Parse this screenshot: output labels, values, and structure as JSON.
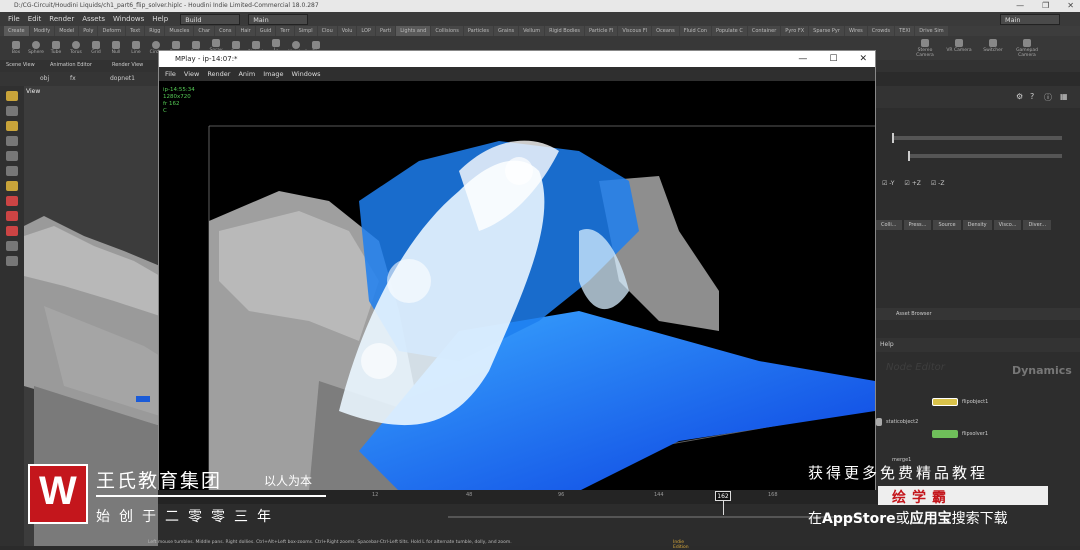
{
  "window": {
    "title": "D:/CG-Circuit/Houdini Liquids/ch1_part6_flip_solver.hiplc - Houdini Indie Limited-Commercial 18.0.287",
    "controls": [
      "—",
      "❐",
      "✕"
    ]
  },
  "menubar": {
    "items": [
      "File",
      "Edit",
      "Render",
      "Assets",
      "Windows",
      "Help"
    ],
    "build_dropdown": "Build",
    "main_dropdown": "Main",
    "right_dropdown": "Main"
  },
  "shelf_tabs": [
    "Create",
    "Modify",
    "Model",
    "Poly",
    "Deform",
    "Text",
    "Rigg",
    "Muscles",
    "Char",
    "Cons",
    "Hair",
    "Guid",
    "Terr",
    "Simpl",
    "Clou",
    "Volu",
    "LOP",
    "Parti",
    "Lights and",
    "Collisions",
    "Particles",
    "Grains",
    "Vellum",
    "Rigid Bodies",
    "Particle Fl",
    "Viscous Fl",
    "Oceans",
    "Fluid Con",
    "Populate C",
    "Container",
    "Pyro FX",
    "Sparse Pyr",
    "Wires",
    "Crowds",
    "TEXI",
    "Drive Sim"
  ],
  "shelf_tools": [
    "Box",
    "Sphere",
    "Tube",
    "Torus",
    "Grid",
    "Null",
    "Line",
    "Circle",
    "Curve",
    "Path",
    "Spray Paint",
    "Font",
    "Platonic",
    "L-System",
    "Metaball",
    "File"
  ],
  "shelf_right_tools": [
    "Stereo Camera",
    "VR Camera",
    "Switcher",
    "Gamepad Camera"
  ],
  "panel_tabs": [
    "Scene View",
    "Animation Editor",
    "Render View"
  ],
  "path": [
    "obj",
    "fx",
    "dopnet1"
  ],
  "viewport_label": "View",
  "mplay": {
    "title": "MPlay - ip-14:07:*",
    "menu": [
      "File",
      "View",
      "Render",
      "Anim",
      "Image",
      "Windows"
    ],
    "info": [
      "ip-14:55:34",
      "1280x720",
      "fr 162",
      "C"
    ]
  },
  "right_panel": {
    "tabs": [
      "Colli...",
      "Press...",
      "Source",
      "Density",
      "Visco...",
      "Diver..."
    ],
    "checks": [
      "-Y",
      "+Z",
      "-Z"
    ],
    "network_menu": [
      "Help"
    ],
    "asset_browser": "Asset Browser",
    "network_title": "Dynamics",
    "watermark": "Node Editor",
    "nodes": [
      "flipobject1",
      "staticobject2",
      "flipsolver1",
      "merge1"
    ]
  },
  "timeline": {
    "ticks": [
      "12",
      "48",
      "96",
      "144",
      "168"
    ],
    "current_frame": "162"
  },
  "status": {
    "message": "Left mouse tumbles. Middle pans. Right dollies. Ctrl+Alt+Left box-zooms. Ctrl+Right zooms. Spacebar-Ctrl-Left tilts. Hold L for alternate tumble, dolly, and zoom.",
    "badge": "Indie Edition"
  },
  "overlay": {
    "brand_name": "王氏教育集团",
    "brand_slogan": "以人为本",
    "brand_sub": "始创于二零零三年",
    "promo_line1": "获得更多免费精品教程",
    "promo_line2": "绘学霸",
    "promo_line3_prefix": "在",
    "promo_line3_store": "AppStore",
    "promo_line3_mid": "或",
    "promo_line3_app": "应用宝",
    "promo_line3_suffix": "搜索下载",
    "logo_letter": "W"
  },
  "colors": {
    "accent_red": "#c4161c",
    "water_blue": "#1a6bff",
    "node_yellow": "#d9c24a",
    "node_green": "#6fbf5a"
  }
}
